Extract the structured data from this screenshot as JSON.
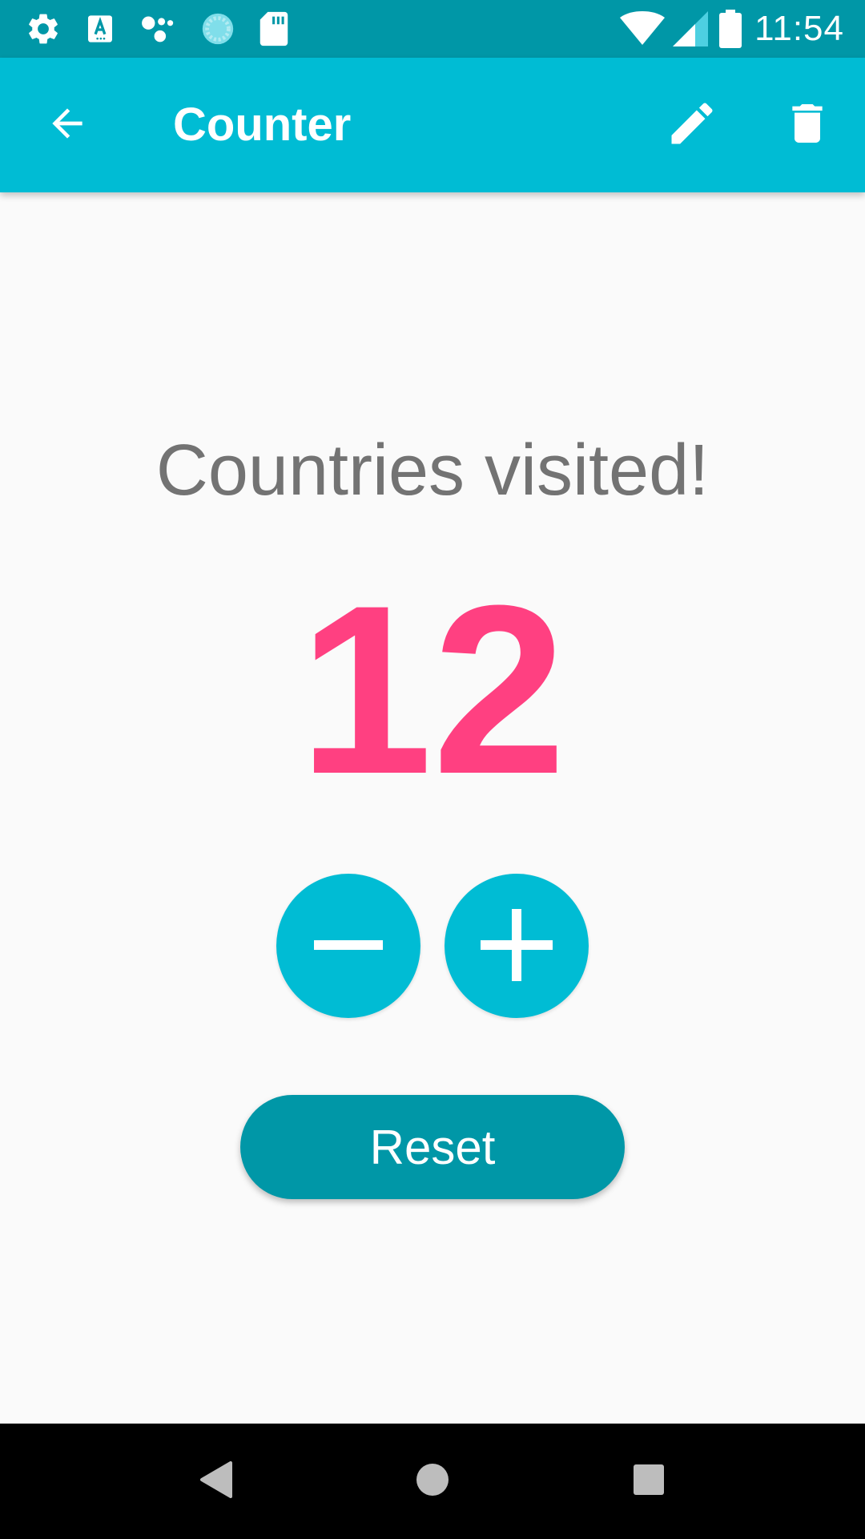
{
  "status_bar": {
    "time": "11:54",
    "left_icons": [
      "gear-icon",
      "keyboard-a-icon",
      "assistant-dots-icon",
      "sync-spinner-icon",
      "sd-card-icon"
    ],
    "right_icons": [
      "wifi-icon",
      "cell-signal-icon",
      "battery-icon"
    ],
    "background": "#0097a7"
  },
  "app_bar": {
    "title": "Counter",
    "background": "#00bcd4",
    "icons": [
      "back-arrow-icon",
      "edit-pencil-icon",
      "delete-trash-icon"
    ]
  },
  "counter": {
    "label": "Countries visited!",
    "value": "12",
    "value_color": "#ff4081",
    "decrement_icon": "minus-icon",
    "increment_icon": "plus-icon"
  },
  "actions": {
    "reset_label": "Reset",
    "reset_color": "#0097a7"
  },
  "nav_bar": {
    "icons": [
      "nav-back-icon",
      "nav-home-icon",
      "nav-recents-icon"
    ]
  }
}
